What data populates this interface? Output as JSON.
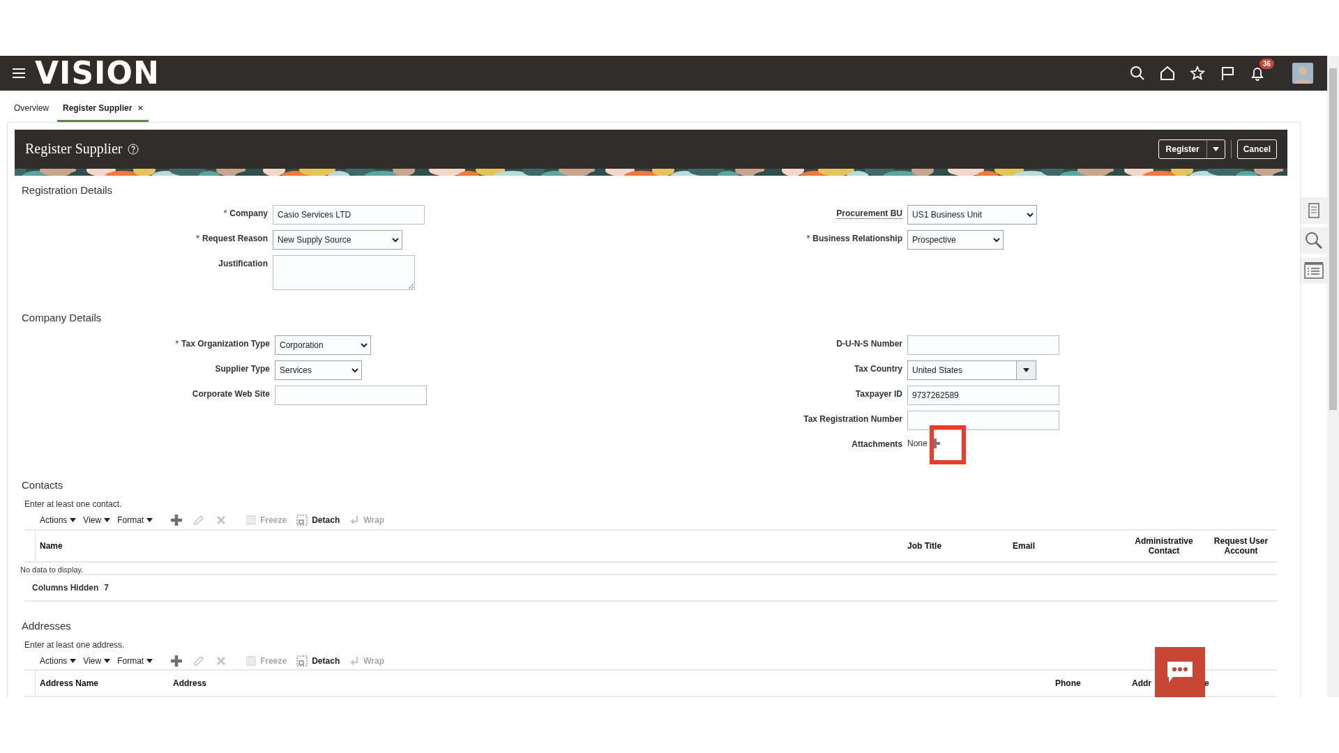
{
  "header": {
    "logo": "VISION",
    "notification_count": "36"
  },
  "tabs": [
    {
      "label": "Overview",
      "selected": false
    },
    {
      "label": "Register Supplier",
      "selected": true,
      "close": "×"
    }
  ],
  "page": {
    "title": "Register Supplier",
    "buttons": [
      {
        "label": "Register",
        "kind": "split"
      },
      {
        "label": "Cancel",
        "kind": "plain"
      }
    ]
  },
  "registration": {
    "heading": "Registration Details",
    "left": [
      {
        "label": "Company",
        "required_mark": "*",
        "kind": "text",
        "value": "Casio Services LTD"
      },
      {
        "label": "Request Reason",
        "required_mark": "*",
        "kind": "select",
        "value": "New Supply Source"
      },
      {
        "label": "Justification",
        "kind": "textarea"
      }
    ],
    "right": [
      {
        "label": "Procurement BU",
        "dotted": true,
        "kind": "select",
        "value": "US1 Business Unit"
      },
      {
        "label": "Business Relationship",
        "required_mark": "*",
        "kind": "select",
        "value": "Prospective"
      }
    ]
  },
  "company": {
    "heading": "Company Details",
    "left": [
      {
        "label": "Tax Organization Type",
        "required_mark": "*",
        "kind": "select",
        "value": "Corporation"
      },
      {
        "label": "Supplier Type",
        "kind": "select",
        "value": "Services"
      },
      {
        "label": "Corporate Web Site",
        "kind": "text"
      }
    ],
    "right": [
      {
        "label": "D-U-N-S Number",
        "kind": "text"
      },
      {
        "label": "Tax Country",
        "kind": "combo",
        "value": "United States"
      },
      {
        "label": "Taxpayer ID",
        "kind": "text",
        "value": "9737262589"
      },
      {
        "label": "Tax Registration Number",
        "kind": "text"
      },
      {
        "label": "Attachments",
        "kind": "attachments",
        "value": "None",
        "highlighted": true
      }
    ]
  },
  "contacts": {
    "heading": "Contacts",
    "note": "Enter at least one contact.",
    "toolbar": [
      {
        "kind": "menu",
        "label": "Actions"
      },
      {
        "kind": "menu",
        "label": "View"
      },
      {
        "kind": "menu",
        "label": "Format"
      },
      {
        "kind": "add",
        "disabled": false
      },
      {
        "kind": "edit",
        "disabled": true
      },
      {
        "kind": "delete",
        "disabled": true
      },
      {
        "kind": "freeze",
        "label": "Freeze",
        "disabled": true
      },
      {
        "kind": "detach",
        "label": "Detach",
        "disabled": false
      },
      {
        "kind": "wrap",
        "label": "Wrap",
        "disabled": true
      }
    ],
    "columns": [
      {
        "label": "Name"
      },
      {
        "label": "Job Title"
      },
      {
        "label": "Email"
      },
      {
        "label": "Administrative Contact"
      },
      {
        "label": "Request User Account"
      }
    ],
    "empty_message": "No data to display.",
    "columns_hidden": {
      "label": "Columns Hidden",
      "count": "7"
    }
  },
  "addresses": {
    "heading": "Addresses",
    "note": "Enter at least one address.",
    "toolbar": [
      {
        "kind": "menu",
        "label": "Actions"
      },
      {
        "kind": "menu",
        "label": "View"
      },
      {
        "kind": "menu",
        "label": "Format"
      },
      {
        "kind": "add",
        "disabled": false
      },
      {
        "kind": "edit",
        "disabled": true
      },
      {
        "kind": "delete",
        "disabled": true
      },
      {
        "kind": "freeze",
        "label": "Freeze",
        "disabled": true
      },
      {
        "kind": "detach",
        "label": "Detach",
        "disabled": false
      },
      {
        "kind": "wrap",
        "label": "Wrap",
        "disabled": true
      }
    ],
    "columns": [
      {
        "label": "Address Name"
      },
      {
        "label": "Address"
      },
      {
        "label": "Phone"
      },
      {
        "label": "Addr",
        "tail": "e"
      }
    ]
  }
}
